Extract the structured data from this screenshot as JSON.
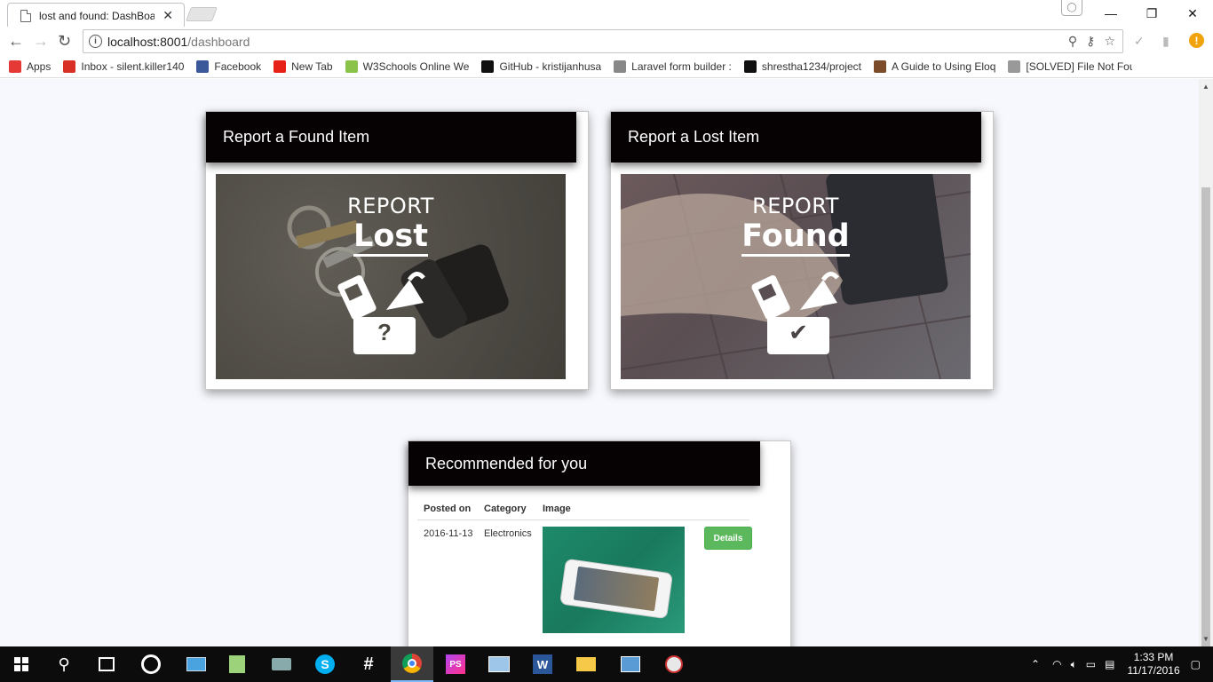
{
  "browser": {
    "tab_title": "lost and found: DashBoard",
    "url_host": "localhost:8001",
    "url_path": "/dashboard",
    "bookmarks": [
      {
        "label": "Apps",
        "icon": "apps-grid-icon",
        "color": "#e53935"
      },
      {
        "label": "Inbox - silent.killer140",
        "icon": "gmail-icon",
        "color": "#d93025"
      },
      {
        "label": "Facebook",
        "icon": "facebook-icon",
        "color": "#3b5998"
      },
      {
        "label": "New Tab",
        "icon": "youtube-icon",
        "color": "#e62117"
      },
      {
        "label": "W3Schools Online We",
        "icon": "w3schools-icon",
        "color": "#8bc34a"
      },
      {
        "label": "GitHub - kristijanhusa",
        "icon": "github-icon",
        "color": "#111111"
      },
      {
        "label": "Laravel form builder :",
        "icon": "page-icon",
        "color": "#888888"
      },
      {
        "label": "shrestha1234/project",
        "icon": "github-icon",
        "color": "#111111"
      },
      {
        "label": "A Guide to Using Eloq",
        "icon": "article-icon",
        "color": "#7b4b2a"
      },
      {
        "label": "[SOLVED] File Not Fou",
        "icon": "forum-icon",
        "color": "#999999"
      }
    ]
  },
  "cards": {
    "found": {
      "header": "Report a Found Item",
      "tile_top": "REPORT",
      "tile_big": "Lost",
      "tile_mark": "?"
    },
    "lost": {
      "header": "Report a Lost Item",
      "tile_top": "REPORT",
      "tile_big": "Found",
      "tile_mark": "✔"
    }
  },
  "recommended": {
    "header": "Recommended for you",
    "columns": [
      "Posted on",
      "Category",
      "Image"
    ],
    "rows": [
      {
        "posted_on": "2016-11-13",
        "category": "Electronics",
        "button": "Details"
      }
    ]
  },
  "taskbar": {
    "time": "1:33 PM",
    "date": "11/17/2016"
  }
}
